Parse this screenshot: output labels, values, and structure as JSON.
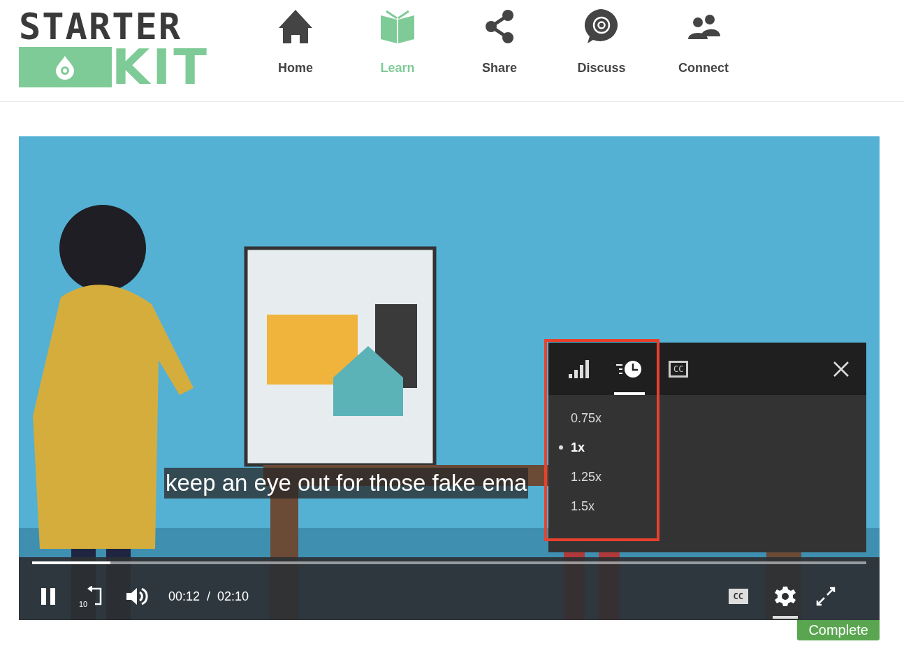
{
  "logo": {
    "top": "STARTER",
    "bottom": "KIT"
  },
  "nav": [
    {
      "label": "Home",
      "kind": "home",
      "selected": false
    },
    {
      "label": "Learn",
      "kind": "learn",
      "selected": true
    },
    {
      "label": "Share",
      "kind": "share",
      "selected": false
    },
    {
      "label": "Discuss",
      "kind": "discuss",
      "selected": false
    },
    {
      "label": "Connect",
      "kind": "connect",
      "selected": false
    }
  ],
  "video": {
    "caption": "keep an eye out for those fake ema",
    "progress": {
      "level": 0.094
    },
    "controls": {
      "playing": true,
      "replay_label": "10",
      "time": "00:12  /  02:10",
      "cc_label": "CC",
      "settings_open": true
    },
    "settings_panel": {
      "tabs": [
        {
          "kind": "quality",
          "selected": false
        },
        {
          "kind": "speed",
          "selected": true
        },
        {
          "kind": "captions",
          "label": "CC",
          "selected": false
        }
      ],
      "speeds": [
        {
          "label": "0.75x",
          "selected": false
        },
        {
          "label": "1x",
          "selected": true
        },
        {
          "label": "1.25x",
          "selected": false
        },
        {
          "label": "1.5x",
          "selected": false
        }
      ],
      "highlighted": true
    }
  },
  "complete_button": "Complete"
}
